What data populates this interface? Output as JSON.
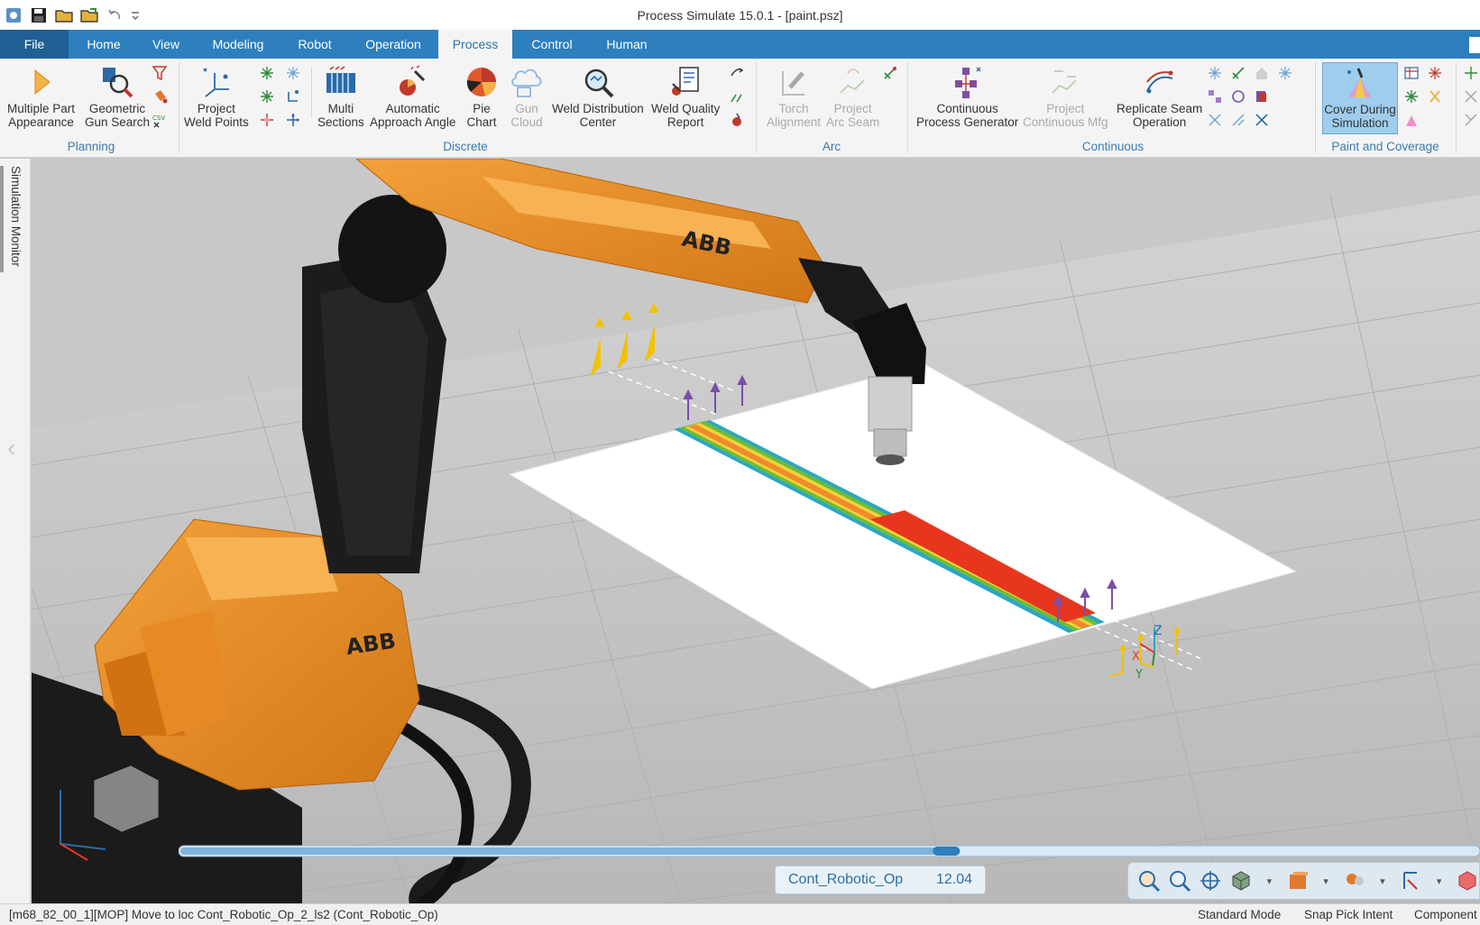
{
  "window": {
    "title": "Process Simulate 15.0.1 - [paint.psz]"
  },
  "qat": [
    "app-icon",
    "save-icon",
    "open-icon",
    "open-folder-icon",
    "undo-icon",
    "customize-icon"
  ],
  "tabs": [
    {
      "label": "File"
    },
    {
      "label": "Home"
    },
    {
      "label": "View"
    },
    {
      "label": "Modeling"
    },
    {
      "label": "Robot"
    },
    {
      "label": "Operation"
    },
    {
      "label": "Process"
    },
    {
      "label": "Control"
    },
    {
      "label": "Human"
    }
  ],
  "ribbon": {
    "planning": {
      "group": "Planning",
      "multi_part": "Multiple Part\nAppearance",
      "geo_gun": "Geometric\nGun Search"
    },
    "discrete": {
      "group": "Discrete",
      "project_weld": "Project\nWeld Points",
      "multi_sections": "Multi\nSections",
      "auto_approach": "Automatic\nApproach Angle",
      "pie_chart": "Pie\nChart",
      "gun_cloud": "Gun\nCloud",
      "weld_dist": "Weld Distribution\nCenter",
      "weld_quality": "Weld Quality\nReport"
    },
    "arc": {
      "group": "Arc",
      "torch": "Torch\nAlignment",
      "project_arc": "Project\nArc Seam"
    },
    "continuous": {
      "group": "Continuous",
      "cont_proc_gen": "Continuous\nProcess Generator",
      "project_cont": "Project\nContinuous Mfg",
      "replicate_seam": "Replicate Seam\nOperation"
    },
    "paint": {
      "group": "Paint and Coverage",
      "cover_during": "Cover During\nSimulation"
    }
  },
  "side_panel": {
    "label": "Simulation Monitor"
  },
  "scene": {
    "robot_brand": "ABB",
    "axis_labels": {
      "z": "Z",
      "x": "X",
      "y": "Y"
    }
  },
  "timeline": {
    "operation": "Cont_Robotic_Op",
    "time": "12.04",
    "progress": 0.59
  },
  "status": {
    "message": "[m68_82_00_1][MOP] Move to loc Cont_Robotic_Op_2_ls2 (Cont_Robotic_Op)",
    "mode": "Standard Mode",
    "snap": "Snap Pick Intent",
    "component": "Component"
  },
  "colors": {
    "ribbon_tab_bar": "#2e7fbd",
    "robot_orange": "#e8891e",
    "floor_gray": "#c4c4c4",
    "accent_blue": "#2e6fa6"
  }
}
